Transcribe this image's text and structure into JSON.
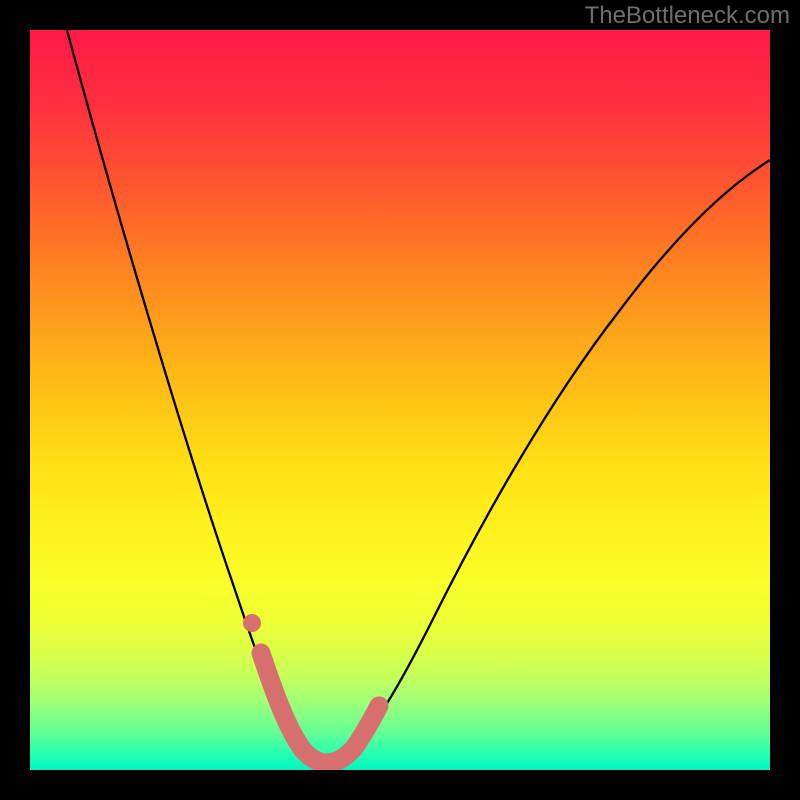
{
  "watermark": "TheBottleneck.com",
  "colors": {
    "frame": "#000000",
    "watermark": "#6f6f6f",
    "curve_stroke": "#000000",
    "highlight_stroke": "#d86f6f",
    "highlight_fill": "#d86f6f",
    "gradient_top": "#ff1a49",
    "gradient_bottom": "#00f5c4"
  },
  "chart_data": {
    "type": "line",
    "title": "",
    "xlabel": "",
    "ylabel": "",
    "xlim": [
      0,
      100
    ],
    "ylim": [
      0,
      100
    ],
    "grid": false,
    "series": [
      {
        "name": "bottleneck-curve",
        "x": [
          5,
          8,
          11,
          14,
          17,
          20,
          23,
          25,
          27,
          29,
          31,
          33,
          35,
          37,
          40,
          44,
          48,
          52,
          56,
          60,
          65,
          70,
          76,
          82,
          88,
          95,
          100
        ],
        "values": [
          100,
          90,
          80,
          71,
          62,
          53,
          45,
          38,
          31,
          24,
          18,
          12,
          7,
          4,
          2,
          3,
          6,
          11,
          17,
          24,
          32,
          41,
          50,
          58,
          65,
          73,
          78
        ]
      }
    ],
    "annotations": [
      {
        "name": "highlight-segment",
        "x": [
          29,
          31,
          33,
          35,
          37,
          40,
          42,
          44
        ],
        "values": [
          21,
          15,
          9,
          5,
          3,
          2,
          2,
          3
        ]
      },
      {
        "name": "highlight-dot",
        "x": 28,
        "value": 24
      }
    ]
  }
}
